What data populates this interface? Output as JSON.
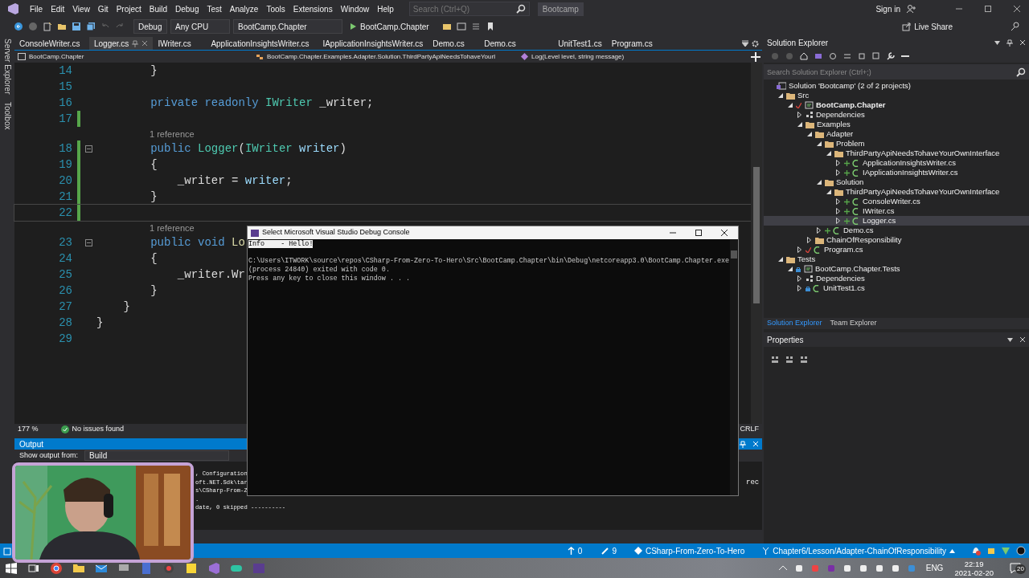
{
  "title_bar": {
    "menus": [
      "File",
      "Edit",
      "View",
      "Git",
      "Project",
      "Build",
      "Debug",
      "Test",
      "Analyze",
      "Tools",
      "Extensions",
      "Window",
      "Help"
    ],
    "search_placeholder": "Search (Ctrl+Q)",
    "solution_name": "Bootcamp",
    "sign_in": "Sign in"
  },
  "toolbar": {
    "configuration": "Debug",
    "platform": "Any CPU",
    "startup_project": "BootCamp.Chapter",
    "run_label": "BootCamp.Chapter",
    "live_share": "Live Share"
  },
  "side_tabs": [
    "Server Explorer",
    "Toolbox"
  ],
  "editor": {
    "tabs": [
      {
        "label": "ConsoleWriter.cs",
        "selected": false
      },
      {
        "label": "Logger.cs",
        "selected": true
      },
      {
        "label": "IWriter.cs",
        "selected": false
      },
      {
        "label": "ApplicationInsightsWriter.cs",
        "selected": false
      },
      {
        "label": "IApplicationInsightsWriter.cs",
        "selected": false
      },
      {
        "label": "Demo.cs",
        "selected": false
      },
      {
        "label": "Demo.cs",
        "selected": false
      },
      {
        "label": "UnitTest1.cs",
        "selected": false
      },
      {
        "label": "Program.cs",
        "selected": false
      }
    ],
    "nav": {
      "project": "BootCamp.Chapter",
      "type": "BootCamp.Chapter.Examples.Adapter.Solution.ThirdPartyApiNeedsTohaveYourI",
      "member": "Log(Level level, string message)"
    },
    "lines": [
      {
        "number": "14",
        "current": false,
        "changed": false,
        "foldable": false,
        "segments": [
          {
            "text": "        }",
            "kind": "punct"
          }
        ]
      },
      {
        "number": "15",
        "current": false,
        "changed": false,
        "foldable": false
      },
      {
        "number": "16",
        "current": false,
        "changed": false,
        "foldable": false,
        "segments": [
          {
            "text": "        private readonly",
            "kind": "kw"
          },
          {
            "text": " IWriter",
            "kind": "type"
          },
          {
            "text": " _writer;",
            "kind": "field"
          }
        ]
      },
      {
        "number": "17",
        "current": false,
        "changed": true,
        "foldable": false
      },
      {
        "number": "18",
        "codelens": "1 reference",
        "current": false,
        "changed": true,
        "foldable": true,
        "segments": [
          {
            "text": "        public",
            "kind": "kw"
          },
          {
            "text": " Logger",
            "kind": "type"
          },
          {
            "text": "(",
            "kind": "punct"
          },
          {
            "text": "IWriter",
            "kind": "type"
          },
          {
            "text": " writer",
            "kind": "param"
          },
          {
            "text": ")",
            "kind": "punct"
          }
        ]
      },
      {
        "number": "19",
        "current": false,
        "changed": true,
        "foldable": false,
        "segments": [
          {
            "text": "        {",
            "kind": "punct"
          }
        ]
      },
      {
        "number": "20",
        "current": false,
        "changed": true,
        "foldable": false,
        "segments": [
          {
            "text": "            _writer",
            "kind": "field"
          },
          {
            "text": " = ",
            "kind": "punct"
          },
          {
            "text": "writer",
            "kind": "param"
          },
          {
            "text": ";",
            "kind": "punct"
          }
        ]
      },
      {
        "number": "21",
        "current": false,
        "changed": true,
        "foldable": false,
        "segments": [
          {
            "text": "        }",
            "kind": "punct"
          }
        ]
      },
      {
        "number": "22",
        "current": true,
        "changed": true,
        "foldable": false
      },
      {
        "number": "23",
        "codelens": "1 reference",
        "current": false,
        "changed": false,
        "foldable": true,
        "segments": [
          {
            "text": "        public void",
            "kind": "kw"
          },
          {
            "text": " Lo",
            "kind": "method"
          }
        ]
      },
      {
        "number": "24",
        "current": false,
        "changed": false,
        "foldable": false,
        "segments": [
          {
            "text": "        {",
            "kind": "punct"
          }
        ]
      },
      {
        "number": "25",
        "current": false,
        "changed": false,
        "foldable": false,
        "segments": [
          {
            "text": "            _writer.Wr",
            "kind": "field"
          }
        ]
      },
      {
        "number": "26",
        "current": false,
        "changed": false,
        "foldable": false,
        "segments": [
          {
            "text": "        }",
            "kind": "punct"
          }
        ]
      },
      {
        "number": "27",
        "current": false,
        "changed": false,
        "foldable": false,
        "segments": [
          {
            "text": "    }",
            "kind": "punct"
          }
        ]
      },
      {
        "number": "28",
        "current": false,
        "changed": false,
        "foldable": false,
        "segments": [
          {
            "text": "}",
            "kind": "punct"
          }
        ]
      },
      {
        "number": "29",
        "current": false,
        "changed": false,
        "foldable": false
      }
    ],
    "zoom": "177 %",
    "issues": "No issues found",
    "line_ending": "CRLF"
  },
  "output": {
    "title": "Output",
    "source_label": "Show output from:",
    "source": "Build",
    "lines": [
      ", Configuration",
      "oft.NET.Sdk\\tar",
      "s\\CSharp-From-Z",
      ".",
      "date, 0 skipped ----------"
    ],
    "right_fragment": "rec"
  },
  "console": {
    "title": "Select Microsoft Visual Studio Debug Console",
    "lines": [
      {
        "text": "Info    - Hello!",
        "selected": true
      },
      {
        "selected": false
      },
      {
        "text": "C:\\Users\\ITWORK\\source\\repos\\CSharp-From-Zero-To-Hero\\Src\\BootCamp.Chapter\\bin\\Debug\\netcoreapp3.0\\BootCamp.Chapter.exe",
        "selected": false
      },
      {
        "text": "(process 24840) exited with code 0.",
        "selected": false
      },
      {
        "text": "Press any key to close this window . . .",
        "selected": false
      }
    ]
  },
  "solution_explorer": {
    "title": "Solution Explorer",
    "search_placeholder": "Search Solution Explorer (Ctrl+;)",
    "tree": [
      {
        "label": "Solution 'Bootcamp' (2 of 2 projects)",
        "kind": "solution",
        "selected": false,
        "startup": false,
        "children": [
          {
            "label": "Src",
            "kind": "folder",
            "expanded": true,
            "selected": false,
            "startup": false,
            "children": [
              {
                "label": "BootCamp.Chapter",
                "kind": "project",
                "expanded": true,
                "git": {
                  "kind": "modified"
                },
                "selected": false,
                "startup": true,
                "children": [
                  {
                    "label": "Dependencies",
                    "kind": "dependencies",
                    "expanded": false,
                    "selected": false,
                    "startup": false
                  },
                  {
                    "label": "Examples",
                    "kind": "folder",
                    "expanded": true,
                    "selected": false,
                    "startup": false,
                    "children": [
                      {
                        "label": "Adapter",
                        "kind": "folder",
                        "expanded": true,
                        "selected": false,
                        "startup": false,
                        "children": [
                          {
                            "label": "Problem",
                            "kind": "folder",
                            "expanded": true,
                            "selected": false,
                            "startup": false,
                            "children": [
                              {
                                "label": "ThirdPartyApiNeedsTohaveYourOwnInterface",
                                "kind": "folder",
                                "expanded": true,
                                "selected": false,
                                "startup": false,
                                "children": [
                                  {
                                    "label": "ApplicationInsightsWriter.cs",
                                    "kind": "file",
                                    "expanded": false,
                                    "git": {
                                      "kind": "added"
                                    },
                                    "selected": false,
                                    "startup": false
                                  },
                                  {
                                    "label": "IApplicationInsightsWriter.cs",
                                    "kind": "file",
                                    "expanded": false,
                                    "git": {
                                      "kind": "added"
                                    },
                                    "selected": false,
                                    "startup": false
                                  }
                                ]
                              }
                            ]
                          },
                          {
                            "label": "Solution",
                            "kind": "folder",
                            "expanded": true,
                            "selected": false,
                            "startup": false,
                            "children": [
                              {
                                "label": "ThirdPartyApiNeedsTohaveYourOwnInterface",
                                "kind": "folder",
                                "expanded": true,
                                "selected": false,
                                "startup": false,
                                "children": [
                                  {
                                    "label": "ConsoleWriter.cs",
                                    "kind": "file",
                                    "expanded": false,
                                    "git": {
                                      "kind": "added"
                                    },
                                    "selected": false,
                                    "startup": false
                                  },
                                  {
                                    "label": "IWriter.cs",
                                    "kind": "file",
                                    "expanded": false,
                                    "git": {
                                      "kind": "added"
                                    },
                                    "selected": false,
                                    "startup": false
                                  },
                                  {
                                    "label": "Logger.cs",
                                    "kind": "file",
                                    "expanded": false,
                                    "git": {
                                      "kind": "added"
                                    },
                                    "selected": true,
                                    "startup": false
                                  }
                                ]
                              }
                            ]
                          },
                          {
                            "label": "Demo.cs",
                            "kind": "file",
                            "expanded": false,
                            "git": {
                              "kind": "added"
                            },
                            "selected": false,
                            "startup": false
                          }
                        ]
                      },
                      {
                        "label": "ChainOfResponsibility",
                        "kind": "folder",
                        "expanded": false,
                        "selected": false,
                        "startup": false
                      }
                    ]
                  },
                  {
                    "label": "Program.cs",
                    "kind": "file",
                    "expanded": false,
                    "git": {
                      "kind": "modified"
                    },
                    "selected": false,
                    "startup": false
                  }
                ]
              }
            ]
          },
          {
            "label": "Tests",
            "kind": "folder",
            "expanded": true,
            "selected": false,
            "startup": false,
            "children": [
              {
                "label": "BootCamp.Chapter.Tests",
                "kind": "project",
                "expanded": true,
                "git": {
                  "kind": "locked"
                },
                "selected": false,
                "startup": false,
                "children": [
                  {
                    "label": "Dependencies",
                    "kind": "dependencies",
                    "expanded": false,
                    "selected": false,
                    "startup": false
                  },
                  {
                    "label": "UnitTest1.cs",
                    "kind": "file",
                    "expanded": false,
                    "git": {
                      "kind": "locked"
                    },
                    "selected": false,
                    "startup": false
                  }
                ]
              }
            ]
          }
        ]
      }
    ],
    "tabs": [
      {
        "label": "Solution Explorer",
        "selected": true
      },
      {
        "label": "Team Explorer",
        "selected": false
      }
    ]
  },
  "properties": {
    "title": "Properties"
  },
  "status_bar": {
    "outgoing": "0",
    "changes": "9",
    "repository": "CSharp-From-Zero-To-Hero",
    "branch": "Chapter6/Lesson/Adapter-ChainOfResponsibility"
  },
  "taskbar": {
    "language": "ENG",
    "time": "22:19",
    "date": "2021-02-20",
    "notification_count": "20"
  }
}
